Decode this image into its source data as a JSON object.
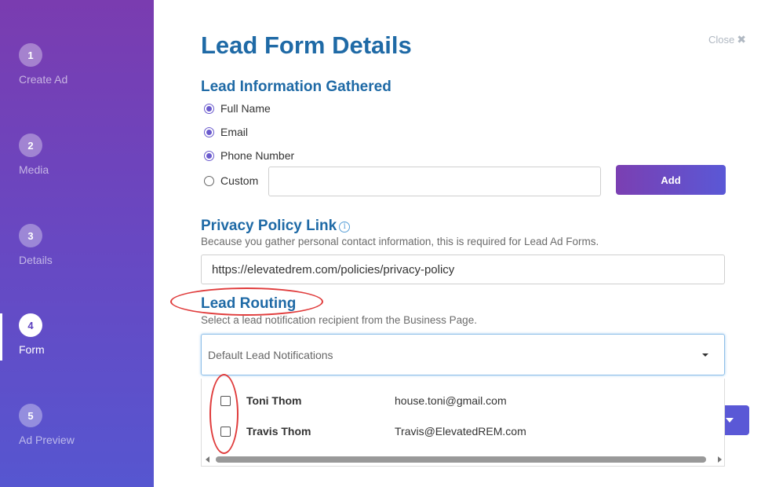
{
  "sidebar": {
    "steps": [
      {
        "number": "1",
        "label": "Create Ad"
      },
      {
        "number": "2",
        "label": "Media"
      },
      {
        "number": "3",
        "label": "Details"
      },
      {
        "number": "4",
        "label": "Form"
      },
      {
        "number": "5",
        "label": "Ad Preview"
      }
    ],
    "active_step": "4"
  },
  "header": {
    "title": "Lead Form Details",
    "close_label": "Close",
    "close_icon": "✖"
  },
  "lead_info": {
    "title": "Lead Information Gathered",
    "options": [
      {
        "label": "Full Name",
        "checked": true
      },
      {
        "label": "Email",
        "checked": true
      },
      {
        "label": "Phone Number",
        "checked": true
      },
      {
        "label": "Custom",
        "checked": false
      }
    ],
    "custom_value": "",
    "add_label": "Add"
  },
  "privacy": {
    "title": "Privacy Policy Link",
    "info_icon": "i",
    "description": "Because you gather personal contact information, this is required for Lead Ad Forms.",
    "url": "https://elevatedrem.com/policies/privacy-policy"
  },
  "routing": {
    "title": "Lead Routing",
    "description": "Select a lead notification recipient from the Business Page.",
    "select_value": "Default Lead Notifications",
    "recipients": [
      {
        "name": "Toni Thom",
        "email": "house.toni@gmail.com",
        "checked": false
      },
      {
        "name": "Travis Thom",
        "email": "Travis@ElevatedREM.com",
        "checked": false
      }
    ]
  },
  "colors": {
    "accent": "#1f6aa6",
    "button_start": "#7b3fb2",
    "button_end": "#5a58d6",
    "annotation": "#e03c3c"
  }
}
